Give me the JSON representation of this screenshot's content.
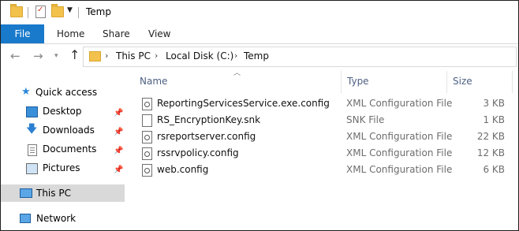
{
  "window": {
    "title": "Temp"
  },
  "ribbon": {
    "tabs": {
      "file": "File",
      "home": "Home",
      "share": "Share",
      "view": "View"
    }
  },
  "address": {
    "crumbs": [
      "This PC",
      "Local Disk (C:)",
      "Temp"
    ],
    "separator": "›"
  },
  "nav": {
    "quick_access": "Quick access",
    "items": [
      {
        "label": "Desktop",
        "icon": "desktop-icon",
        "pinned": true
      },
      {
        "label": "Downloads",
        "icon": "downloads-icon",
        "pinned": true
      },
      {
        "label": "Documents",
        "icon": "documents-icon",
        "pinned": true
      },
      {
        "label": "Pictures",
        "icon": "pictures-icon",
        "pinned": true
      }
    ],
    "this_pc": "This PC",
    "network": "Network"
  },
  "list": {
    "headers": {
      "name": "Name",
      "type": "Type",
      "size": "Size"
    },
    "files": [
      {
        "name": "ReportingServicesService.exe.config",
        "type": "XML Configuration File",
        "size": "3 KB",
        "icon": "config-file-icon"
      },
      {
        "name": "RS_EncryptionKey.snk",
        "type": "SNK File",
        "size": "1 KB",
        "icon": "file-icon"
      },
      {
        "name": "rsreportserver.config",
        "type": "XML Configuration File",
        "size": "22 KB",
        "icon": "config-file-icon"
      },
      {
        "name": "rssrvpolicy.config",
        "type": "XML Configuration File",
        "size": "12 KB",
        "icon": "config-file-icon"
      },
      {
        "name": "web.config",
        "type": "XML Configuration File",
        "size": "6 KB",
        "icon": "config-file-icon"
      }
    ]
  },
  "colors": {
    "accent": "#1979ca",
    "selected_bg": "#d9d9d9",
    "header_text": "#4d6082"
  }
}
